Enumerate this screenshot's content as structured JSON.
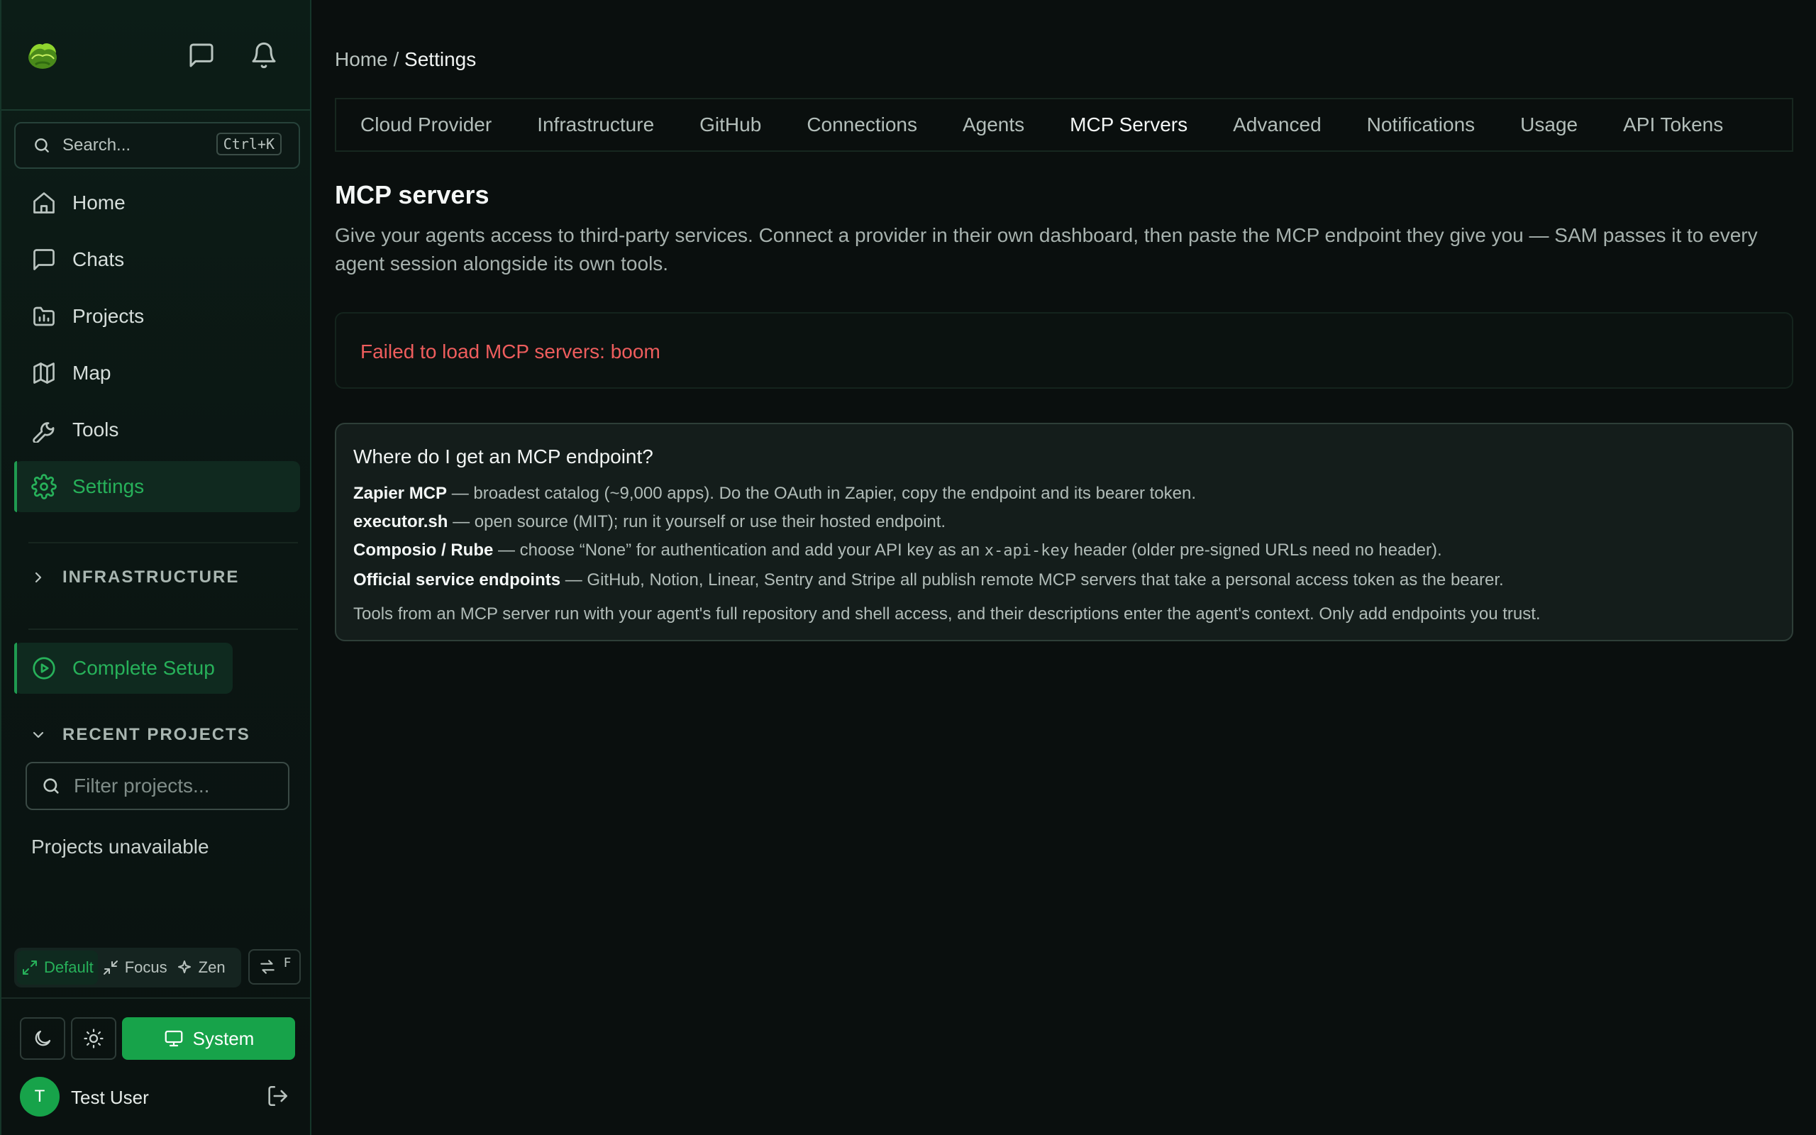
{
  "sidebar": {
    "search": {
      "placeholder": "Search...",
      "shortcut": "Ctrl+K"
    },
    "nav": [
      {
        "label": "Home",
        "icon": "home-icon"
      },
      {
        "label": "Chats",
        "icon": "chat-icon"
      },
      {
        "label": "Projects",
        "icon": "projects-icon"
      },
      {
        "label": "Map",
        "icon": "map-icon"
      },
      {
        "label": "Tools",
        "icon": "wrench-icon"
      },
      {
        "label": "Settings",
        "icon": "gear-icon",
        "active": true
      }
    ],
    "infrastructure_label": "INFRASTRUCTURE",
    "complete_setup_label": "Complete Setup",
    "recent_projects_label": "RECENT PROJECTS",
    "filter_placeholder": "Filter projects...",
    "projects_unavailable": "Projects unavailable",
    "modes": [
      {
        "label": "Default",
        "active": true
      },
      {
        "label": "Focus"
      },
      {
        "label": "Zen"
      }
    ],
    "swap_key": "F",
    "system_label": "System",
    "user": {
      "initial": "T",
      "name": "Test User"
    }
  },
  "main": {
    "breadcrumb": {
      "home": "Home",
      "separator": " / ",
      "current": "Settings"
    },
    "tabs": [
      "Cloud Provider",
      "Infrastructure",
      "GitHub",
      "Connections",
      "Agents",
      "MCP Servers",
      "Advanced",
      "Notifications",
      "Usage",
      "API Tokens"
    ],
    "active_tab": "MCP Servers",
    "heading": "MCP servers",
    "description": "Give your agents access to third-party services. Connect a provider in their own dashboard, then paste the MCP endpoint they give you — SAM passes it to every agent session alongside its own tools.",
    "error": "Failed to load MCP servers: boom",
    "help": {
      "title": "Where do I get an MCP endpoint?",
      "items": [
        {
          "name": "Zapier MCP",
          "text": " — broadest catalog (~9,000 apps). Do the OAuth in Zapier, copy the endpoint and its bearer token."
        },
        {
          "name": "executor.sh",
          "text": " — open source (MIT); run it yourself or use their hosted endpoint."
        },
        {
          "name": "Composio / Rube",
          "text_before": " — choose “None” for authentication and add your API key as an ",
          "code": "x-api-key",
          "text_after": " header (older pre-signed URLs need no header)."
        },
        {
          "name": "Official service endpoints",
          "text": " — GitHub, Notion, Linear, Sentry and Stripe all publish remote MCP servers that take a personal access token as the bearer."
        }
      ],
      "note": "Tools from an MCP server run with your agent's full repository and shell access, and their descriptions enter the agent's context. Only add endpoints you trust."
    }
  },
  "colors": {
    "accent": "#17a34a",
    "accent_text": "#27b15a",
    "error": "#ee5d5d",
    "background": "#0a0f0e"
  }
}
